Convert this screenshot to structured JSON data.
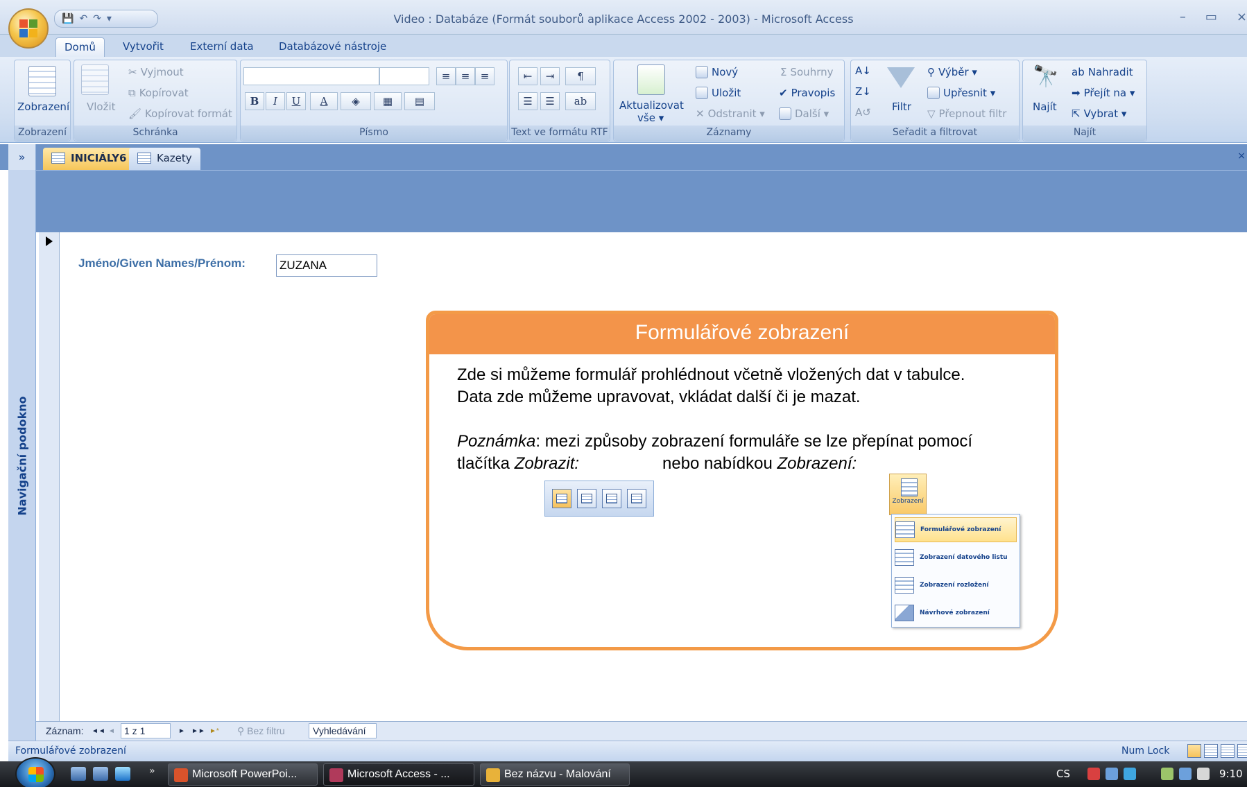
{
  "window": {
    "title": "Video : Databáze (Formát souborů aplikace Access 2002 - 2003) - Microsoft Access",
    "controls": [
      "–",
      "▭",
      "×"
    ]
  },
  "ribbon_tabs": [
    "Domů",
    "Vytvořit",
    "Externí data",
    "Databázové nástroje"
  ],
  "ribbon": {
    "views": {
      "button": "Zobrazení",
      "group": "Zobrazení"
    },
    "clipboard": {
      "paste": "Vložit",
      "cut": "Vyjmout",
      "copy": "Kopírovat",
      "format_painter": "Kopírovat formát",
      "group": "Schránka"
    },
    "font": {
      "bold": "B",
      "italic": "I",
      "underline": "U",
      "font_color": "A",
      "group": "Písmo"
    },
    "rtf": {
      "group": "Text ve formátu RTF"
    },
    "records": {
      "refresh": "Aktualizovat",
      "refresh2": "vše ▾",
      "new": "Nový",
      "save": "Uložit",
      "delete": "Odstranit ▾",
      "totals": "Souhrny",
      "spelling": "Pravopis",
      "more": "Další ▾",
      "group": "Záznamy"
    },
    "sort_filter": {
      "filter": "Filtr",
      "selection": "Výběr ▾",
      "advanced": "Upřesnit ▾",
      "toggle": "Přepnout filtr",
      "group": "Seřadit a filtrovat"
    },
    "find": {
      "find": "Najít",
      "replace": "Nahradit",
      "goto": "Přejít na ▾",
      "select": "Vybrat ▾",
      "group": "Najít"
    }
  },
  "doc_tabs": {
    "toggle": "»",
    "active": "INICIÁLY6",
    "other": "Kazety",
    "close": "×"
  },
  "nav_pane": {
    "label": "Navigační podokno"
  },
  "form": {
    "field_label": "Jméno/Given Names/Prénom:",
    "field_value": "ZUZANA"
  },
  "callout": {
    "title": "Formulářové zobrazení",
    "line1": "Zde si můžeme formulář prohlédnout včetně vložených dat v tabulce.",
    "line2": "Data zde můžeme upravovat, vkládat další či je mazat.",
    "note_label": "Poznámka",
    "note_rest": ": mezi způsoby zobrazení formuláře se lze přepínat pomocí",
    "line4_a": "tlačítka ",
    "line4_b": "Zobrazit:",
    "line4_c": "nebo nabídkou ",
    "line4_d": "Zobrazení:",
    "menu_button": "Zobrazení",
    "menu_items": [
      "Formulářové zobrazení",
      "Zobrazení datového listu",
      "Zobrazení rozložení",
      "Návrhové zobrazení"
    ]
  },
  "record_nav": {
    "label": "Záznam:",
    "first": "◄◄",
    "prev": "◄",
    "position": "1 z 1",
    "next": "►",
    "last": "►►",
    "new": "►*",
    "filter": "Bez filtru",
    "search": "Vyhledávání"
  },
  "status": {
    "left": "Formulářové zobrazení",
    "num_lock": "Num Lock"
  },
  "taskbar": {
    "chevron": "»",
    "tasks": [
      "Microsoft PowerPoi...",
      "Microsoft Access - ...",
      "Bez názvu - Malování"
    ],
    "lang": "CS",
    "clock": "9:10"
  }
}
